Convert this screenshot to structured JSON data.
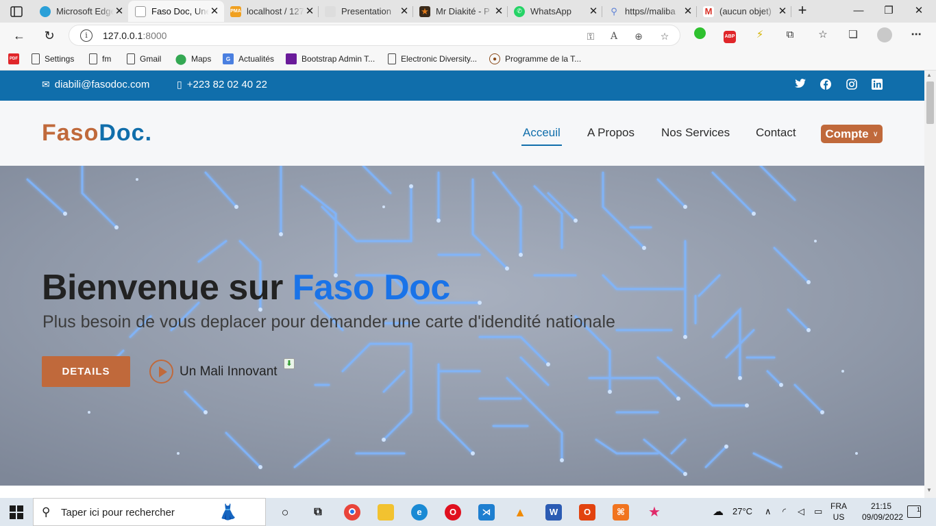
{
  "browser": {
    "tabs": [
      {
        "title": "Microsoft Edge",
        "icon": "edge-icon",
        "color": "#2aa0d8"
      },
      {
        "title": "Faso Doc, Une",
        "icon": "page-icon",
        "color": "#9a9a9a"
      },
      {
        "title": "localhost / 127",
        "icon": "phpmyadmin-icon",
        "color": "#f0a020"
      },
      {
        "title": "Presentation",
        "icon": "page-icon",
        "color": "#bbbbbb"
      },
      {
        "title": "Mr Diakité - P",
        "icon": "star-icon",
        "color": "#e07a1a"
      },
      {
        "title": "WhatsApp",
        "icon": "whatsapp-icon",
        "color": "#25d366"
      },
      {
        "title": "https//maliba",
        "icon": "search-icon",
        "color": "#5a7fd6"
      },
      {
        "title": "(aucun objet)",
        "icon": "gmail-icon",
        "color": "#d93025"
      }
    ],
    "active_tab": 1,
    "address": {
      "host": "127.0.0.1",
      "port": ":8000"
    },
    "bookmarks": [
      {
        "label": "",
        "icon": "pdf-icon"
      },
      {
        "label": "Settings",
        "icon": "page-icon"
      },
      {
        "label": "fm",
        "icon": "page-icon"
      },
      {
        "label": "Gmail",
        "icon": "page-icon"
      },
      {
        "label": "Maps",
        "icon": "maps-icon"
      },
      {
        "label": "Actualités",
        "icon": "news-icon"
      },
      {
        "label": "Bootstrap Admin T...",
        "icon": "bootstrap-icon"
      },
      {
        "label": "Electronic Diversity...",
        "icon": "page-icon"
      },
      {
        "label": "Programme de la T...",
        "icon": "program-icon"
      }
    ]
  },
  "site": {
    "topbar": {
      "email": "diabili@fasodoc.com",
      "phone": "+223 82 02 40 22",
      "social": [
        "twitter-icon",
        "facebook-icon",
        "instagram-icon",
        "linkedin-icon"
      ]
    },
    "logo": {
      "part1": "Faso",
      "part2": "Doc."
    },
    "nav": {
      "home": "Acceuil",
      "about": "A Propos",
      "services": "Nos Services",
      "contact": "Contact",
      "account": "Compte"
    },
    "hero": {
      "title_prefix": "Bienvenue sur ",
      "title_accent": "Faso Doc",
      "subtitle": "Plus besoin de vous deplacer pour demander une carte d'idendité nationale",
      "details_button": "DETAILS",
      "video_label": "Un Mali Innovant"
    },
    "colors": {
      "primary": "#106eab",
      "accent": "#c0693b",
      "highlight": "#1a73e8"
    }
  },
  "taskbar": {
    "search_placeholder": "Taper ici pour rechercher",
    "weather": "27°C",
    "lang_top": "FRA",
    "lang_bottom": "US",
    "time": "21:15",
    "date": "09/09/2022",
    "notifications": "1"
  }
}
